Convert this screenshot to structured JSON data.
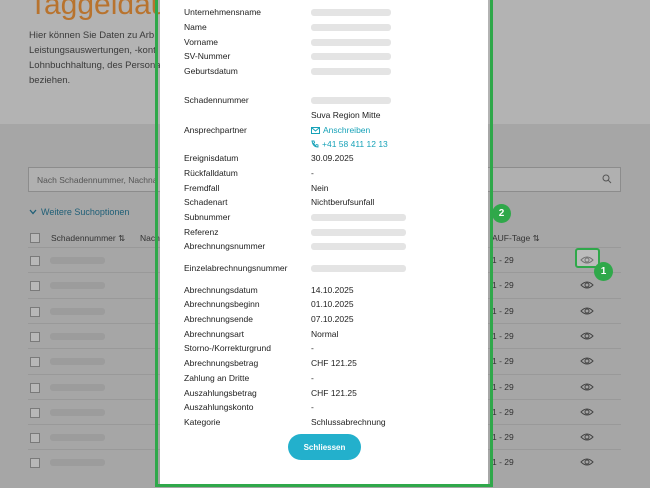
{
  "background": {
    "title": "Taggeldaus",
    "intro": "Hier können Sie Daten zu Arb Leistungsauswertungen, -kont Lohnbuchhaltung, des Persona beziehen.",
    "search_placeholder": "Nach Schadennummer, Nachna",
    "more_options_label": "Weitere Suchoptionen",
    "columns": [
      "Schadennummer",
      "Nach",
      "AUF-Tage"
    ],
    "rows": [
      {
        "days": "1 - 29"
      },
      {
        "days": "1 - 29"
      },
      {
        "days": "1 - 29"
      },
      {
        "days": "1 - 29"
      },
      {
        "days": "1 - 29"
      },
      {
        "days": "1 - 29"
      },
      {
        "days": "1 - 29"
      },
      {
        "days": "1 - 29"
      },
      {
        "days": "1 - 29"
      }
    ]
  },
  "modal": {
    "fields": [
      {
        "label": "Unternehmensname",
        "value": ""
      },
      {
        "label": "Name",
        "value": ""
      },
      {
        "label": "Vorname",
        "value": ""
      },
      {
        "label": "SV-Nummer",
        "value": ""
      },
      {
        "label": "Geburtsdatum",
        "value": ""
      },
      {
        "label": "Schadennummer",
        "value": ""
      },
      {
        "label": "Ereignisdatum",
        "value": "30.09.2025"
      },
      {
        "label": "Rückfalldatum",
        "value": "-"
      },
      {
        "label": "Fremdfall",
        "value": "Nein"
      },
      {
        "label": "Schadenart",
        "value": "Nichtberufsunfall"
      },
      {
        "label": "Subnummer",
        "value": ""
      },
      {
        "label": "Referenz",
        "value": ""
      },
      {
        "label": "Abrechnungsnummer",
        "value": ""
      },
      {
        "label": "Einzelabrechnungsnummer",
        "value": ""
      },
      {
        "label": "Abrechnungsdatum",
        "value": "14.10.2025"
      },
      {
        "label": "Abrechnungsbeginn",
        "value": "01.10.2025"
      },
      {
        "label": "Abrechnungsende",
        "value": "07.10.2025"
      },
      {
        "label": "Abrechnungsart",
        "value": "Normal"
      },
      {
        "label": "Storno-/Korrekturgrund",
        "value": "-"
      },
      {
        "label": "Abrechnungsbetrag",
        "value": "CHF 121.25"
      },
      {
        "label": "Zahlung an Dritte",
        "value": "-"
      },
      {
        "label": "Auszahlungsbetrag",
        "value": "CHF 121.25"
      },
      {
        "label": "Auszahlungskonto",
        "value": "-"
      },
      {
        "label": "Kategorie",
        "value": "Schlussabrechnung"
      }
    ],
    "contact": {
      "label": "Ansprechpartner",
      "region": "Suva Region Mitte",
      "email_link": "Anschreiben",
      "phone": "+41 58 411 12 13"
    },
    "close_label": "Schliessen"
  },
  "annotations": {
    "badge_1": "1",
    "badge_2": "2",
    "highlight_color": "#2fa84a"
  }
}
